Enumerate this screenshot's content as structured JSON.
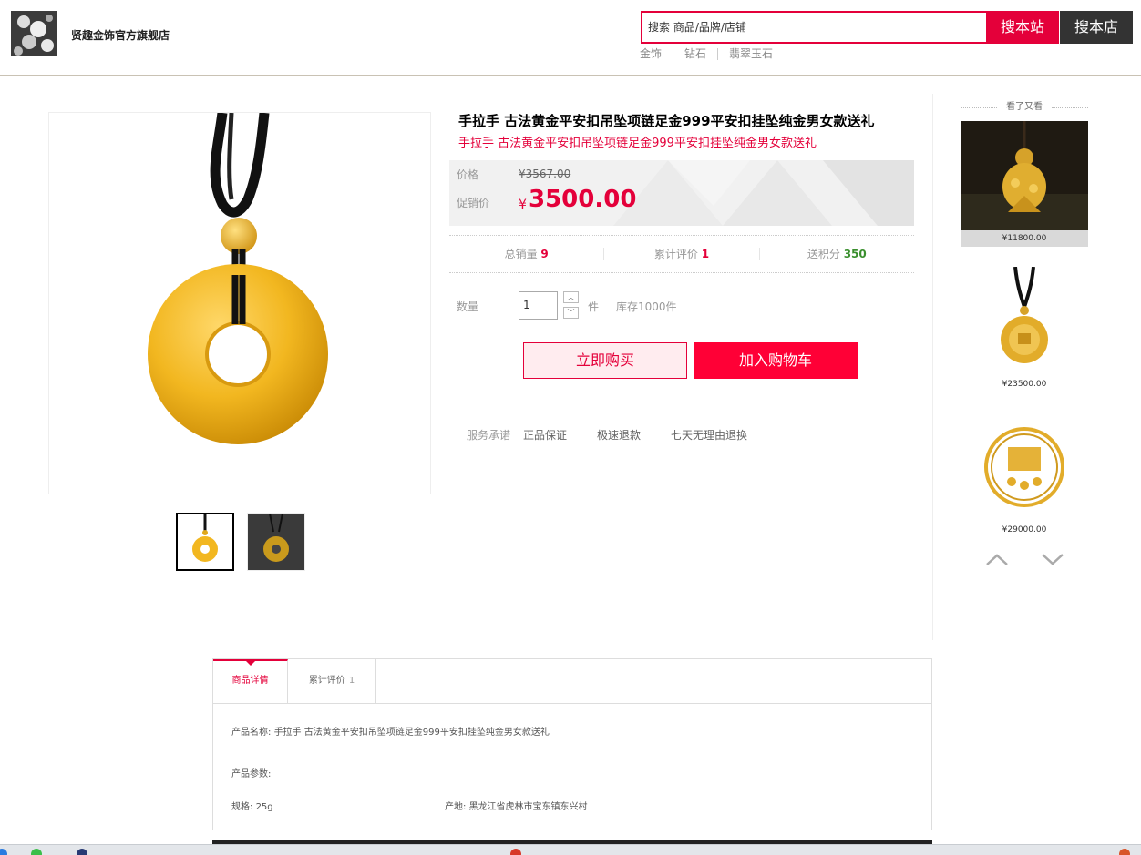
{
  "header": {
    "store_name": "贤趣金饰官方旗舰店",
    "search_placeholder": "搜索 商品/品牌/店铺",
    "search_site_label": "搜本站",
    "search_store_label": "搜本店",
    "hot_words": [
      "金饰",
      "钻石",
      "翡翠玉石"
    ]
  },
  "product": {
    "title": "手拉手 古法黄金平安扣吊坠项链足金999平安扣挂坠纯金男女款送礼",
    "subtitle": "手拉手 古法黄金平安扣吊坠项链足金999平安扣挂坠纯金男女款送礼",
    "price_label": "价格",
    "original_price": "¥3567.00",
    "promo_label": "促销价",
    "currency": "¥",
    "promo_price": "3500.00",
    "stats": [
      {
        "label": "总销量",
        "value": "9"
      },
      {
        "label": "累计评价",
        "value": "1"
      },
      {
        "label": "送积分",
        "value": "350"
      }
    ],
    "quantity_label": "数量",
    "quantity_value": "1",
    "unit": "件",
    "stock": "库存1000件",
    "buy_now": "立即购买",
    "add_cart": "加入购物车",
    "service_label": "服务承诺",
    "services": [
      "正品保证",
      "极速退款",
      "七天无理由退换"
    ]
  },
  "sidebar": {
    "title": "看了又看",
    "items": [
      {
        "price": "¥11800.00"
      },
      {
        "price": "¥23500.00"
      },
      {
        "price": "¥29000.00"
      }
    ]
  },
  "tabs": [
    {
      "label": "商品详情"
    },
    {
      "label": "累计评价",
      "count": "1"
    }
  ],
  "detail": {
    "name_label": "产品名称:",
    "name_value": "手拉手 古法黄金平安扣吊坠项链足金999平安扣挂坠纯金男女款送礼",
    "params_label": "产品参数:",
    "spec_label": "规格:",
    "spec_value": "25g",
    "origin_label": "产地:",
    "origin_value": "黑龙江省虎林市宝东镇东兴村"
  },
  "colors": {
    "accent": "#e4003a",
    "cart": "#ff0036",
    "points": "#3a8f2e"
  }
}
